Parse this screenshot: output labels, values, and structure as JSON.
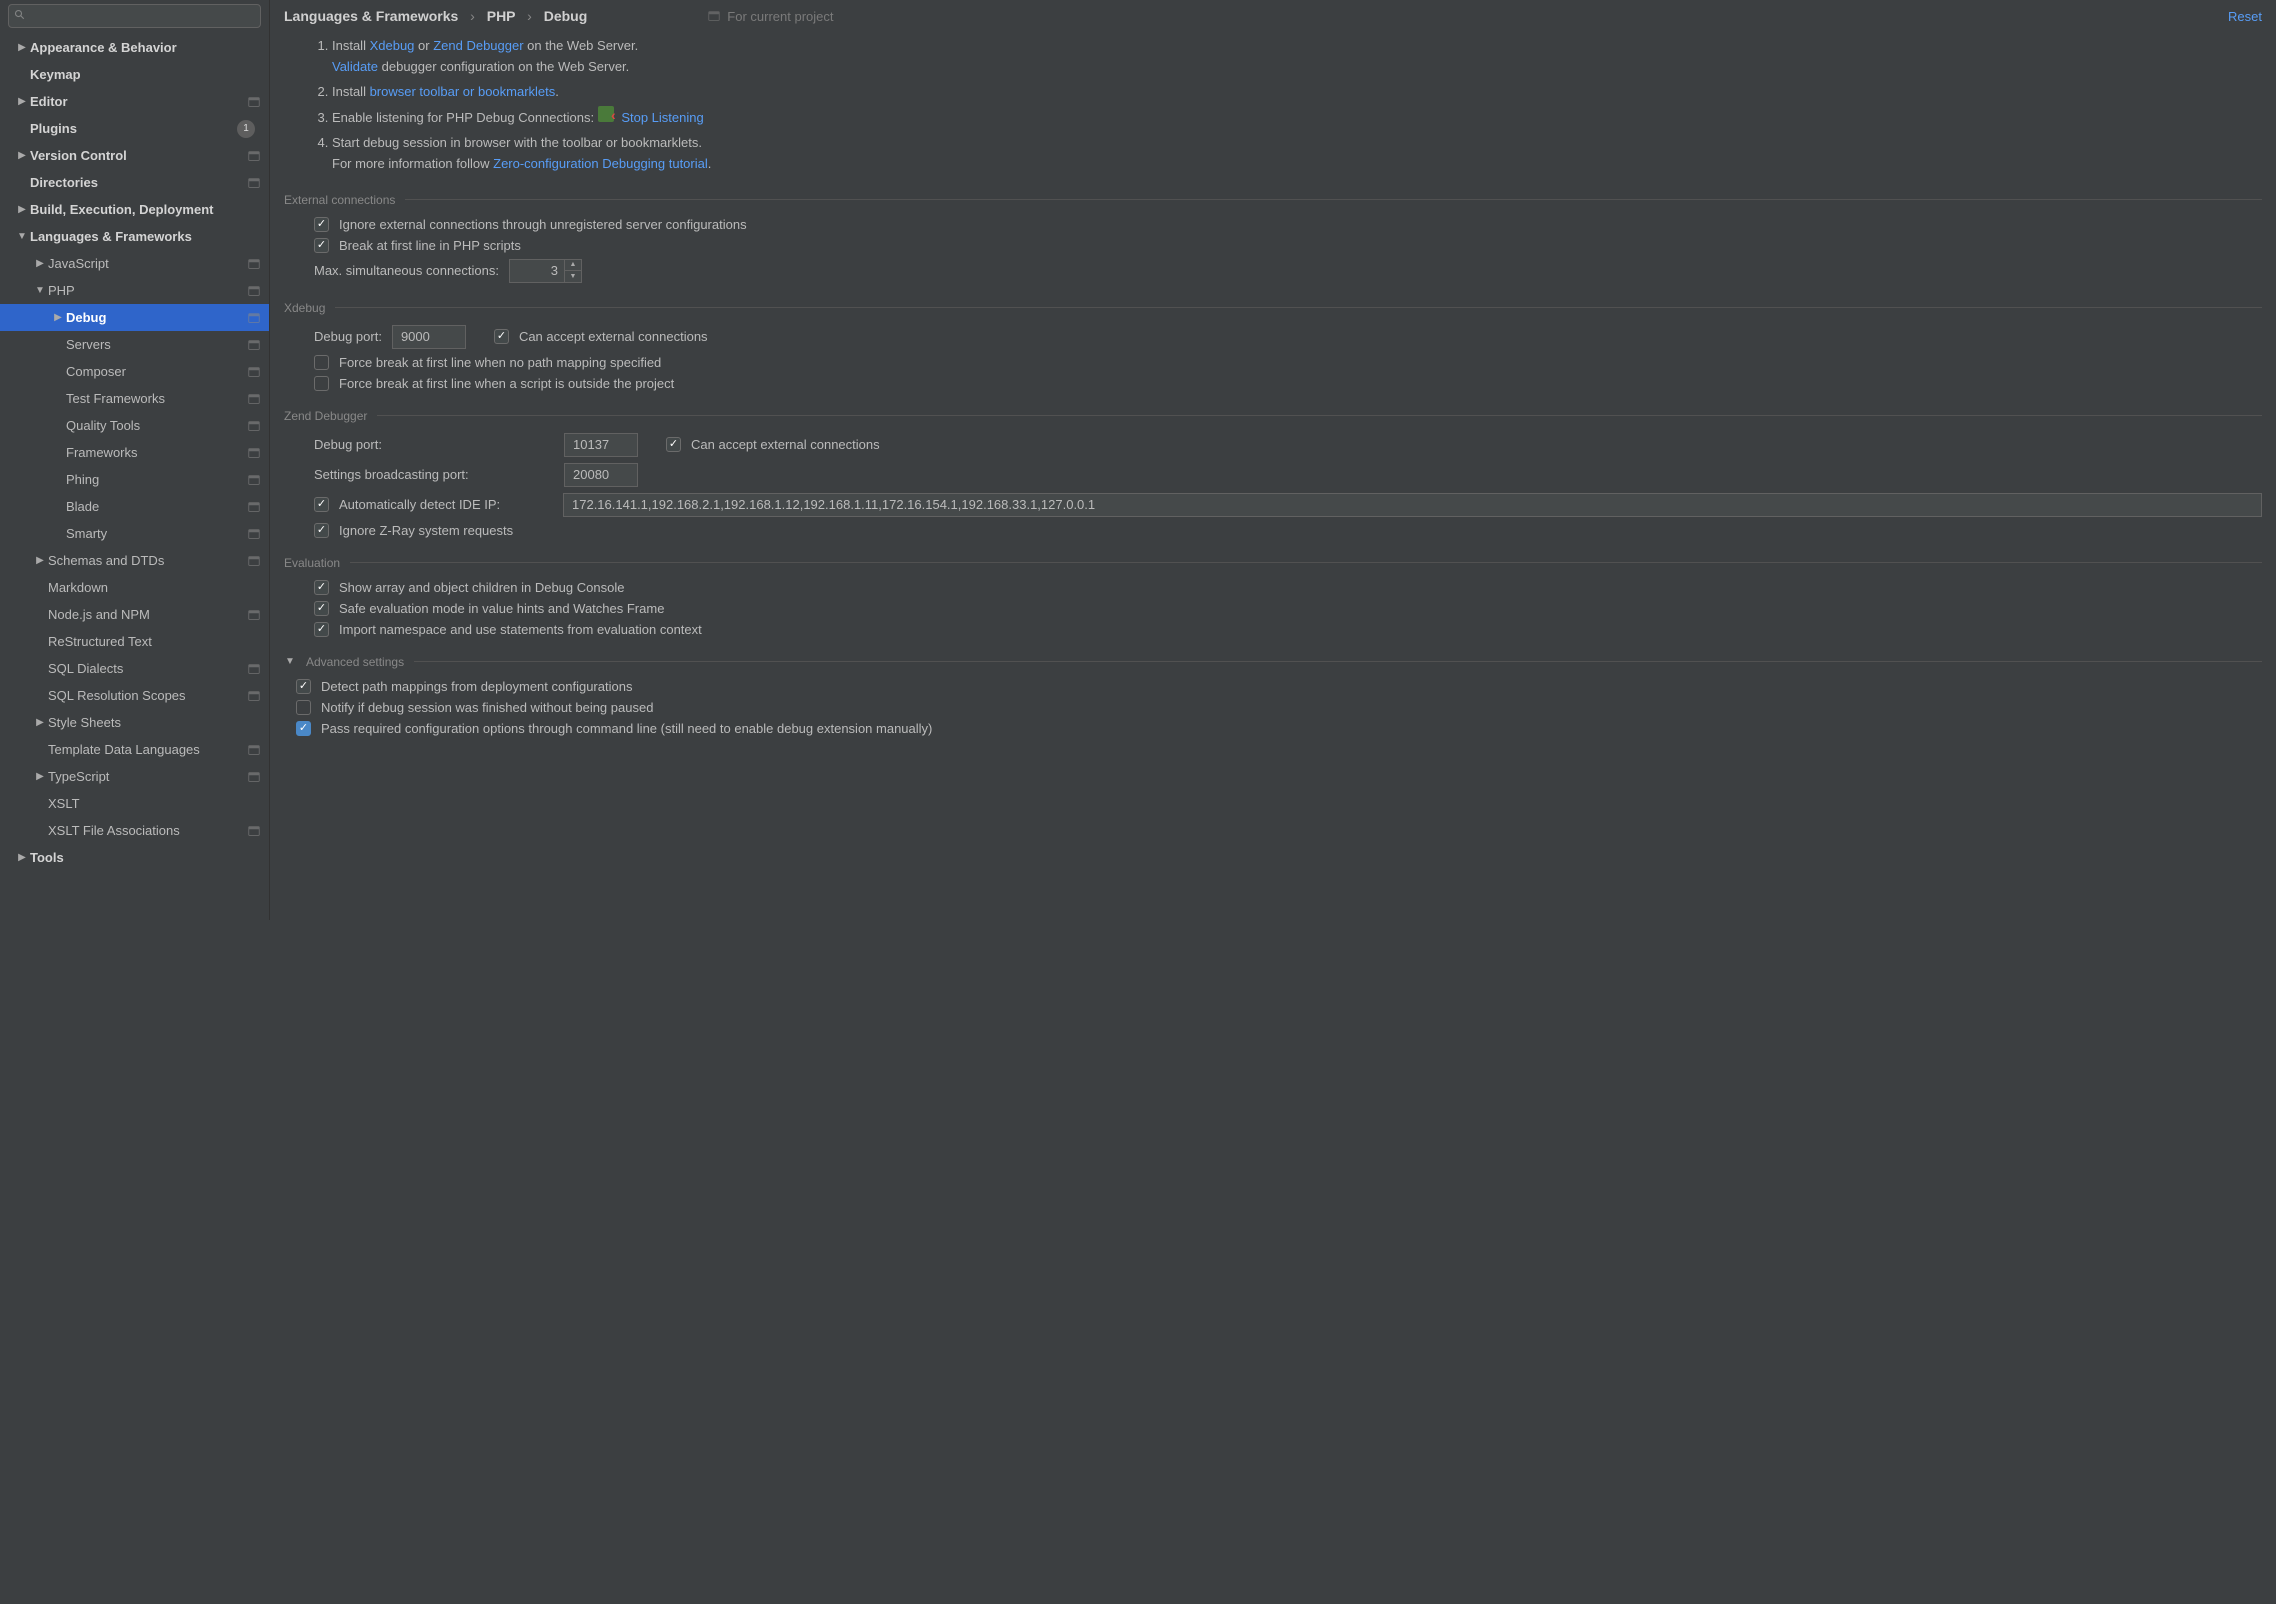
{
  "search": {
    "placeholder": ""
  },
  "sidebar": {
    "items": [
      {
        "label": "Appearance & Behavior",
        "bold": true,
        "arrow": "right",
        "pad": 0
      },
      {
        "label": "Keymap",
        "bold": true,
        "pad": 0,
        "noarrow": true
      },
      {
        "label": "Editor",
        "bold": true,
        "arrow": "right",
        "pad": 0,
        "proj": true
      },
      {
        "label": "Plugins",
        "bold": true,
        "pad": 0,
        "noarrow": true,
        "badge": "1"
      },
      {
        "label": "Version Control",
        "bold": true,
        "arrow": "right",
        "pad": 0,
        "proj": true
      },
      {
        "label": "Directories",
        "bold": true,
        "pad": 0,
        "noarrow": true,
        "proj": true
      },
      {
        "label": "Build, Execution, Deployment",
        "bold": true,
        "arrow": "right",
        "pad": 0
      },
      {
        "label": "Languages & Frameworks",
        "bold": true,
        "arrow": "down",
        "pad": 0
      },
      {
        "label": "JavaScript",
        "arrow": "right",
        "pad": 1,
        "proj": true
      },
      {
        "label": "PHP",
        "arrow": "down",
        "pad": 1,
        "proj": true
      },
      {
        "label": "Debug",
        "arrow": "right",
        "pad": 2,
        "proj": true,
        "selected": true
      },
      {
        "label": "Servers",
        "pad": 2,
        "noarrow": true,
        "proj": true
      },
      {
        "label": "Composer",
        "pad": 2,
        "noarrow": true,
        "proj": true
      },
      {
        "label": "Test Frameworks",
        "pad": 2,
        "noarrow": true,
        "proj": true
      },
      {
        "label": "Quality Tools",
        "pad": 2,
        "noarrow": true,
        "proj": true
      },
      {
        "label": "Frameworks",
        "pad": 2,
        "noarrow": true,
        "proj": true
      },
      {
        "label": "Phing",
        "pad": 2,
        "noarrow": true,
        "proj": true
      },
      {
        "label": "Blade",
        "pad": 2,
        "noarrow": true,
        "proj": true
      },
      {
        "label": "Smarty",
        "pad": 2,
        "noarrow": true,
        "proj": true
      },
      {
        "label": "Schemas and DTDs",
        "arrow": "right",
        "pad": 1,
        "proj": true
      },
      {
        "label": "Markdown",
        "pad": 1,
        "noarrow": true
      },
      {
        "label": "Node.js and NPM",
        "pad": 1,
        "noarrow": true,
        "proj": true
      },
      {
        "label": "ReStructured Text",
        "pad": 1,
        "noarrow": true
      },
      {
        "label": "SQL Dialects",
        "pad": 1,
        "noarrow": true,
        "proj": true
      },
      {
        "label": "SQL Resolution Scopes",
        "pad": 1,
        "noarrow": true,
        "proj": true
      },
      {
        "label": "Style Sheets",
        "arrow": "right",
        "pad": 1
      },
      {
        "label": "Template Data Languages",
        "pad": 1,
        "noarrow": true,
        "proj": true
      },
      {
        "label": "TypeScript",
        "arrow": "right",
        "pad": 1,
        "proj": true
      },
      {
        "label": "XSLT",
        "pad": 1,
        "noarrow": true
      },
      {
        "label": "XSLT File Associations",
        "pad": 1,
        "noarrow": true,
        "proj": true
      },
      {
        "label": "Tools",
        "bold": true,
        "arrow": "right",
        "pad": 0
      }
    ]
  },
  "header": {
    "crumb1": "Languages & Frameworks",
    "crumb2": "PHP",
    "crumb3": "Debug",
    "forproject": "For current project",
    "reset": "Reset"
  },
  "steps": {
    "s1a": "Install ",
    "s1b": "Xdebug",
    "s1c": " or ",
    "s1d": "Zend Debugger",
    "s1e": " on the Web Server.",
    "s1f": "Validate",
    "s1g": " debugger configuration on the Web Server.",
    "s2a": "Install ",
    "s2b": "browser toolbar or bookmarklets",
    "s2c": ".",
    "s3a": "Enable listening for PHP Debug Connections: ",
    "s3b": "Stop Listening",
    "s4a": "Start debug session in browser with the toolbar or bookmarklets.",
    "s4b": "For more information follow ",
    "s4c": "Zero-configuration Debugging tutorial",
    "s4d": "."
  },
  "ext": {
    "title": "External connections",
    "ignore": "Ignore external connections through unregistered server configurations",
    "break": "Break at first line in PHP scripts",
    "maxlabel": "Max. simultaneous connections:",
    "max": "3"
  },
  "xdebug": {
    "title": "Xdebug",
    "portlabel": "Debug port:",
    "port": "9000",
    "accept": "Can accept external connections",
    "force1": "Force break at first line when no path mapping specified",
    "force2": "Force break at first line when a script is outside the project"
  },
  "zend": {
    "title": "Zend Debugger",
    "portlabel": "Debug port:",
    "port": "10137",
    "accept": "Can accept external connections",
    "bcastlabel": "Settings broadcasting port:",
    "bcast": "20080",
    "auto": "Automatically detect IDE IP:",
    "ips": "172.16.141.1,192.168.2.1,192.168.1.12,192.168.1.11,172.16.154.1,192.168.33.1,127.0.0.1",
    "zray": "Ignore Z-Ray system requests"
  },
  "eval": {
    "title": "Evaluation",
    "e1": "Show array and object children in Debug Console",
    "e2": "Safe evaluation mode in value hints and Watches Frame",
    "e3": "Import namespace and use statements from evaluation context"
  },
  "adv": {
    "title": "Advanced settings",
    "a1": "Detect path mappings from deployment configurations",
    "a2": "Notify if debug session was finished without being paused",
    "a3": "Pass required configuration options through command line (still need to enable debug extension manually)"
  }
}
